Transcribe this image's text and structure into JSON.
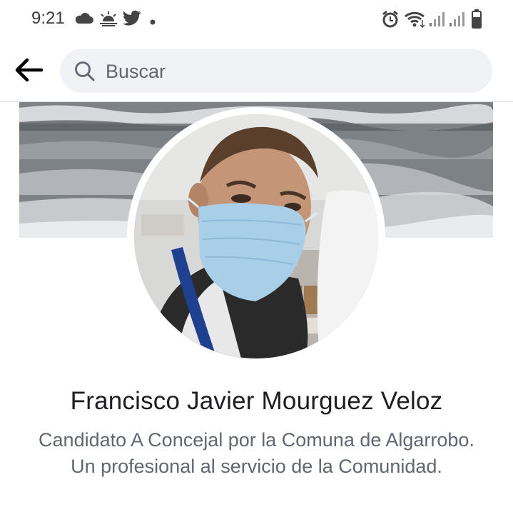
{
  "status_bar": {
    "time": "9:21",
    "left_icons": [
      "cloud-icon",
      "sunrise-icon",
      "twitter-icon",
      "dot-icon"
    ],
    "right_icons": [
      "alarm-icon",
      "wifi-icon",
      "signal-icon",
      "signal-icon",
      "battery-icon"
    ]
  },
  "header": {
    "back_icon": "arrow-left-icon",
    "search_placeholder": "Buscar"
  },
  "profile": {
    "name": "Francisco Javier Mourguez Veloz",
    "bio": "Candidato A Concejal por la Comuna de Algarrobo. Un profesional al servicio de la Comunidad."
  },
  "colors": {
    "background": "#ffffff",
    "search_bg": "#f0f2f5",
    "name_text": "#1c1e21",
    "secondary_text": "#606770",
    "mask": "#9fc7e6",
    "lanyard": "#1f3f8f"
  }
}
